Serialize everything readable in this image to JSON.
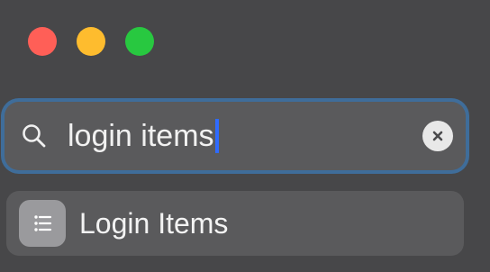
{
  "window": {
    "controls": [
      "close",
      "minimize",
      "zoom"
    ]
  },
  "search": {
    "value": "login items",
    "clear_icon": "clear-icon",
    "search_icon": "search-icon"
  },
  "results": [
    {
      "label": "Login Items",
      "icon": "list-icon"
    }
  ]
}
